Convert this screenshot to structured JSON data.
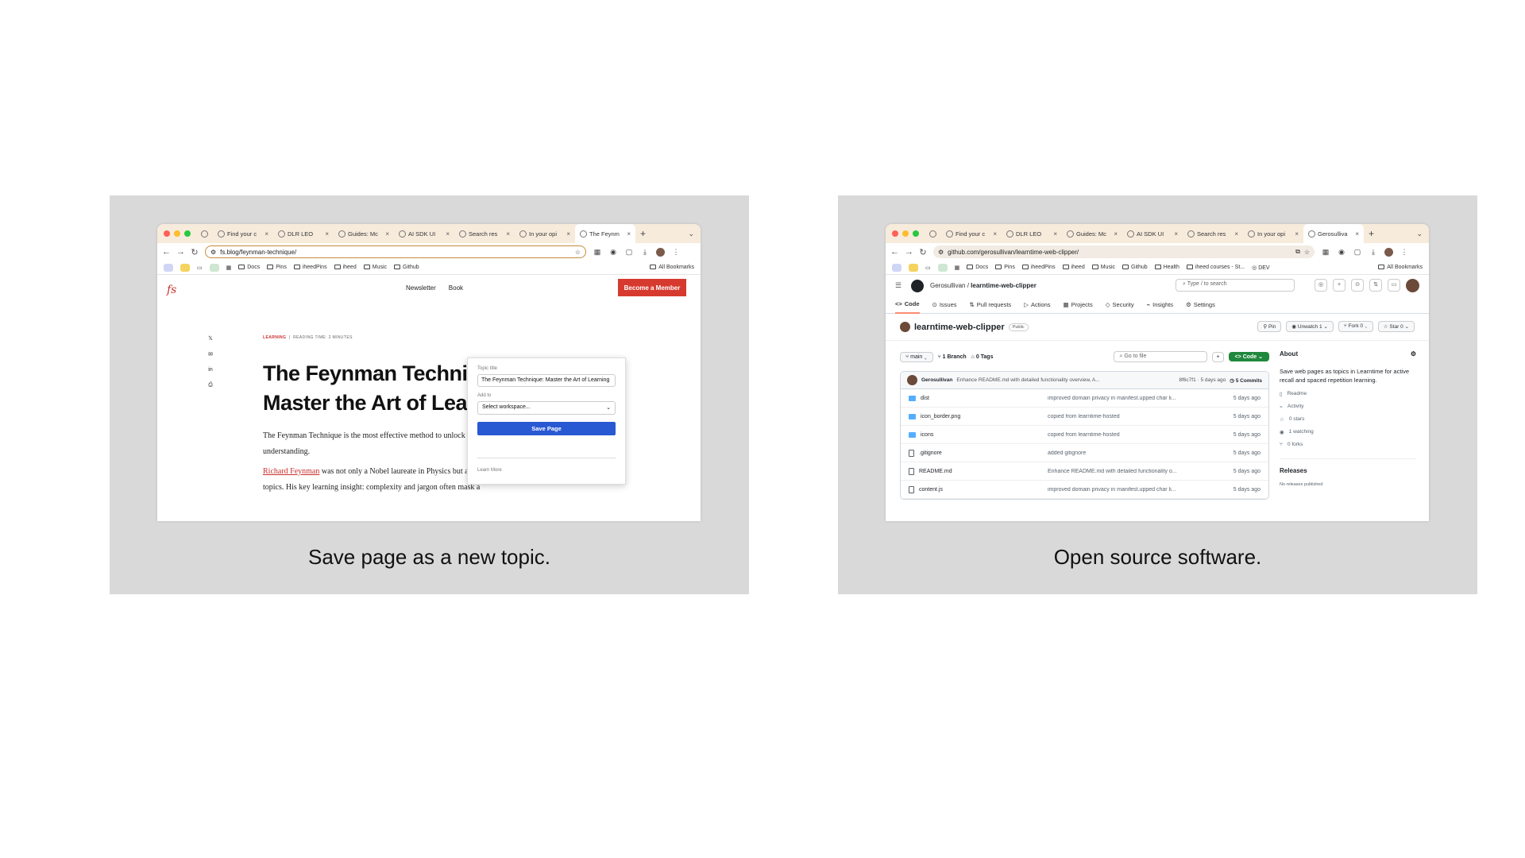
{
  "left": {
    "caption": "Save page as a new topic.",
    "tabs": [
      "Find your c",
      "DLR LEO",
      "Guides: Mc",
      "AI SDK UI",
      "Search res",
      "In your opi",
      "The Feynm"
    ],
    "url": "fs.blog/feynman-technique/",
    "bookmarks": [
      "Docs",
      "Pins",
      "iheedPins",
      "iheed",
      "Music",
      "Github"
    ],
    "all_bookmarks": "All Bookmarks",
    "site": {
      "logo": "fs",
      "nav": [
        "Newsletter",
        "Book"
      ],
      "member_btn": "Become a Member",
      "kicker_cat": "LEARNING",
      "kicker_time": "READING TIME: 2 MINUTES",
      "title": "The Feynman Technique: Master the Art of Learning",
      "p1": "The Feynman Technique is the most effective method to unlock your potential and develop a deep understanding.",
      "p2_link": "Richard Feynman",
      "p2_rest": " was not only a Nobel laureate in Physics but also a master of demystifying complex topics. His key learning insight: complexity and jargon often mask a"
    },
    "popup": {
      "title_label": "Topic title",
      "title_value": "The Feynman Technique: Master the Art of Learning",
      "add_label": "Add to",
      "workspace": "Select workspace...",
      "save": "Save Page",
      "learn_more": "Learn More"
    }
  },
  "right": {
    "caption": "Open source software.",
    "tabs": [
      "Find your c",
      "DLR LEO",
      "Guides: Mc",
      "AI SDK UI",
      "Search res",
      "In your opi",
      "Gerosulliva"
    ],
    "url": "github.com/gerosullivan/learntime-web-clipper/",
    "bookmarks": [
      "Docs",
      "Pins",
      "iheedPins",
      "iheed",
      "Music",
      "Github",
      "Health",
      "iheed courses - St...",
      "DEV"
    ],
    "all_bookmarks": "All Bookmarks",
    "gh": {
      "owner": "Gerosullivan",
      "repo": "learntime-web-clipper",
      "search": "Type / to search",
      "tabs": [
        "Code",
        "Issues",
        "Pull requests",
        "Actions",
        "Projects",
        "Security",
        "Insights",
        "Settings"
      ],
      "repo_title": "learntime-web-clipper",
      "visibility": "Public",
      "pin": "Pin",
      "unwatch": "Unwatch",
      "unwatch_count": "1",
      "fork": "Fork",
      "fork_count": "0",
      "star": "Star",
      "star_count": "0",
      "branch": "main",
      "branches": "1 Branch",
      "tags": "0 Tags",
      "goto": "Go to file",
      "code_btn": "Code",
      "commit_author": "Gerosullivan",
      "commit_msg": "Enhance README.md with detailed functionality overview, A...",
      "commit_meta": "8f6c7f1 · 5 days ago",
      "commits": "5 Commits",
      "files": [
        {
          "name": "dist",
          "type": "folder",
          "msg": "improved domain privacy in manifest.upped char li...",
          "date": "5 days ago"
        },
        {
          "name": "icon_border.png",
          "type": "folder",
          "msg": "copied from learntime-hosted",
          "date": "5 days ago"
        },
        {
          "name": "icons",
          "type": "folder",
          "msg": "copied from learntime-hosted",
          "date": "5 days ago"
        },
        {
          "name": ".gitignore",
          "type": "file",
          "msg": "added gitignore",
          "date": "5 days ago"
        },
        {
          "name": "README.md",
          "type": "file",
          "msg": "Enhance README.md with detailed functionality o...",
          "date": "5 days ago"
        },
        {
          "name": "content.js",
          "type": "file",
          "msg": "improved domain privacy in manifest.upped char li...",
          "date": "5 days ago"
        }
      ],
      "about_title": "About",
      "about_desc": "Save web pages as topics in Learntime for active recall and spaced repetition learning.",
      "stats": [
        "Readme",
        "Activity",
        "0 stars",
        "1 watching",
        "0 forks"
      ],
      "releases": "Releases",
      "releases_sub": "No releases published"
    }
  }
}
